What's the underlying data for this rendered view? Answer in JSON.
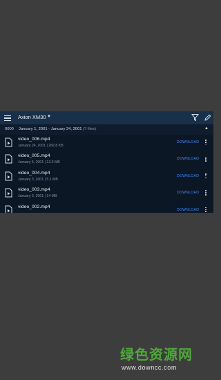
{
  "toolbar": {
    "title": "Axion XM30",
    "menu_icon": "hamburger-menu-icon",
    "filter_icon": "filter-icon",
    "edit_icon": "pencil-edit-icon"
  },
  "group": {
    "id": "0000",
    "range": "January 1, 2001 - January 24, 2001",
    "count": "(7 files)"
  },
  "files": [
    {
      "name": "video_006.mp4",
      "meta": "January 24, 2001 | 282.8 KB",
      "action": "DOWNLOAD"
    },
    {
      "name": "video_005.mp4",
      "meta": "January 5, 2001 | 13.3 MB",
      "action": "DOWNLOAD"
    },
    {
      "name": "video_004.mp4",
      "meta": "January 3, 2001 | 5.1 MB",
      "action": "DOWNLOAD"
    },
    {
      "name": "video_003.mp4",
      "meta": "January 3, 2001 | 14 MB",
      "action": "DOWNLOAD"
    },
    {
      "name": "video_002.mp4",
      "meta": "",
      "action": "DOWNLOAD"
    }
  ],
  "watermark": {
    "logo_text": "绿色资源网",
    "url": "www.downcc.com"
  },
  "colors": {
    "background": "#3d3d3d",
    "app_bg": "#0c1726",
    "toolbar_bg": "#18304a",
    "accent": "#3d8bff",
    "watermark_green": "#4fa83a"
  }
}
